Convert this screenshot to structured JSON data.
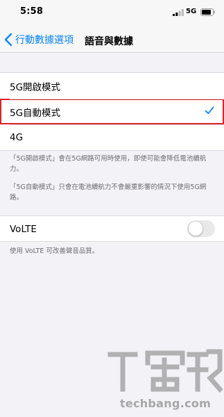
{
  "status_bar": {
    "time": "5:58",
    "carrier": "5G",
    "signal_icon": "signal-bars-icon",
    "battery_icon": "battery-icon"
  },
  "nav": {
    "back_label": "行動數據選項",
    "title": "語音與數據",
    "accent_color": "#0a84ff"
  },
  "modes": [
    {
      "label": "5G開啟模式",
      "selected": false
    },
    {
      "label": "5G自動模式",
      "selected": true
    },
    {
      "label": "4G",
      "selected": false
    }
  ],
  "descriptions": [
    "「5G開啟模式」會在5G網路可用時使用，即使可能會降低電池續航力。",
    "「5G自動模式」只會在電池續航力不會嚴重影響的情況下使用5G網路。"
  ],
  "volte": {
    "label": "VoLTE",
    "enabled": false,
    "footer": "使用 VoLTE 可改善聲音品質。"
  },
  "watermark": {
    "text": "techbang.com",
    "logo_icon": "techbang-logo-icon"
  },
  "highlight_color": "#e0212b"
}
